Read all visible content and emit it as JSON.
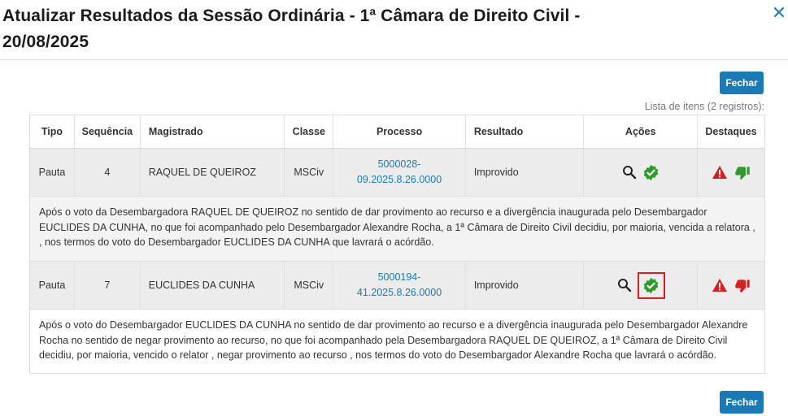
{
  "modal": {
    "title": "Atualizar Resultados da Sessão Ordinária - 1ª Câmara de Direito Civil - 20/08/2025",
    "close_icon": "close-icon"
  },
  "buttons": {
    "fechar_top": "Fechar",
    "fechar_bottom": "Fechar"
  },
  "list_info": "Lista de itens (2 registros):",
  "table": {
    "headers": [
      "Tipo",
      "Sequência",
      "Magistrado",
      "Classe",
      "Processo",
      "Resultado",
      "Ações",
      "Destaques"
    ],
    "rows": [
      {
        "tipo": "Pauta",
        "sequencia": "4",
        "magistrado": "RAQUEL DE QUEIROZ",
        "classe": "MSCiv",
        "processo_line1": "5000028-",
        "processo_line2": "09.2025.8.26.0000",
        "resultado": "Improvido",
        "descricao": "Após o voto da Desembargadora RAQUEL DE QUEIROZ no sentido de dar provimento ao recurso e a divergência inaugurada pelo Desembargador EUCLIDES DA CUNHA, no que foi acompanhado pelo Desembargador Alexandre Rocha, a 1ª Câmara de Direito Civil decidiu, por maioria, vencida a relatora , , nos termos do voto do Desembargador EUCLIDES DA CUNHA que lavrará o acórdão.",
        "thumb_color": "#2e9a2e"
      },
      {
        "tipo": "Pauta",
        "sequencia": "7",
        "magistrado": "EUCLIDES DA CUNHA",
        "classe": "MSCiv",
        "processo_line1": "5000194-",
        "processo_line2": "41.2025.8.26.0000",
        "resultado": "Improvido",
        "descricao": "Após o voto do Desembargador EUCLIDES DA CUNHA no sentido de dar provimento ao recurso e a divergência inaugurada pelo Desembargador Alexandre Rocha no sentido de negar provimento ao recurso, no que foi acompanhado pela Desembargadora RAQUEL DE QUEIROZ, a 1ª Câmara de Direito Civil decidiu, por maioria, vencido o relator , negar provimento ao recurso , nos termos do voto do Desembargador Alexandre Rocha que lavrará o acórdão.",
        "thumb_color": "#d42020"
      }
    ]
  },
  "colors": {
    "accent": "#1a7ab5",
    "check_green": "#2e9a2e",
    "warning_red": "#d42020",
    "highlight_border": "#d81e1e"
  }
}
